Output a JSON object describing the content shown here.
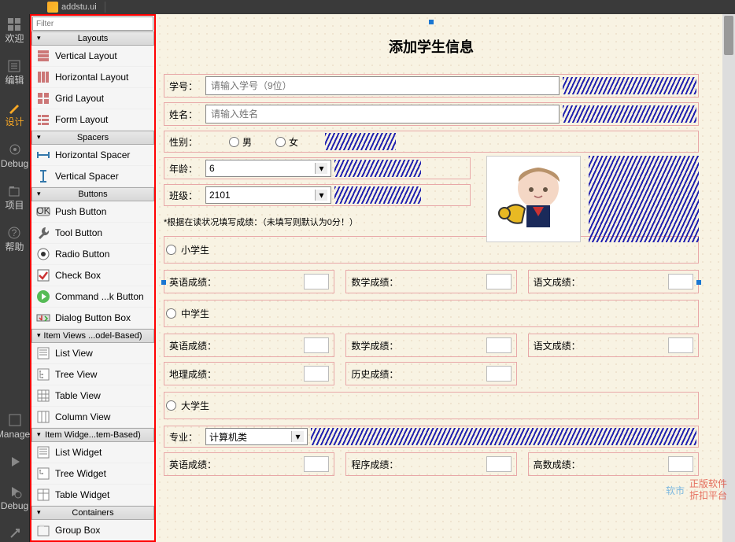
{
  "toolbar": {
    "filename": "addstu.ui"
  },
  "leftbar": {
    "items": [
      "欢迎",
      "编辑",
      "设计",
      "Debug",
      "项目",
      "帮助",
      "Manager",
      "",
      "Debug"
    ]
  },
  "widgetbox": {
    "filter_placeholder": "Filter",
    "sections": [
      {
        "title": "Layouts",
        "items": [
          "Vertical Layout",
          "Horizontal Layout",
          "Grid Layout",
          "Form Layout"
        ]
      },
      {
        "title": "Spacers",
        "items": [
          "Horizontal Spacer",
          "Vertical Spacer"
        ]
      },
      {
        "title": "Buttons",
        "items": [
          "Push Button",
          "Tool Button",
          "Radio Button",
          "Check Box",
          "Command ...k Button",
          "Dialog Button Box"
        ]
      },
      {
        "title": "Item Views ...odel-Based)",
        "items": [
          "List View",
          "Tree View",
          "Table View",
          "Column View"
        ]
      },
      {
        "title": "Item Widge...tem-Based)",
        "items": [
          "List Widget",
          "Tree Widget",
          "Table Widget"
        ]
      },
      {
        "title": "Containers",
        "items": [
          "Group Box"
        ]
      }
    ]
  },
  "form": {
    "title": "添加学生信息",
    "id_label": "学号：",
    "id_placeholder": "请输入学号（9位）",
    "name_label": "姓名：",
    "name_placeholder": "请输入姓名",
    "sex_label": "性别：",
    "sex_male": "男",
    "sex_female": "女",
    "age_label": "年龄：",
    "age_value": "6",
    "class_label": "班级：",
    "class_value": "2101",
    "note": "*根据在读状况填写成绩：（未填写则默认为0分！）",
    "stage_primary": "小学生",
    "stage_middle": "中学生",
    "stage_college": "大学生",
    "score_en": "英语成绩：",
    "score_math": "数学成绩：",
    "score_cn": "语文成绩：",
    "score_geo": "地理成绩：",
    "score_his": "历史成绩：",
    "major_label": "专业：",
    "major_value": "计算机类",
    "score_prog": "程序成绩：",
    "score_adv": "高数成绩："
  },
  "watermark": {
    "brand": "软市",
    "l1": "正版软件",
    "l2": "折扣平台"
  }
}
